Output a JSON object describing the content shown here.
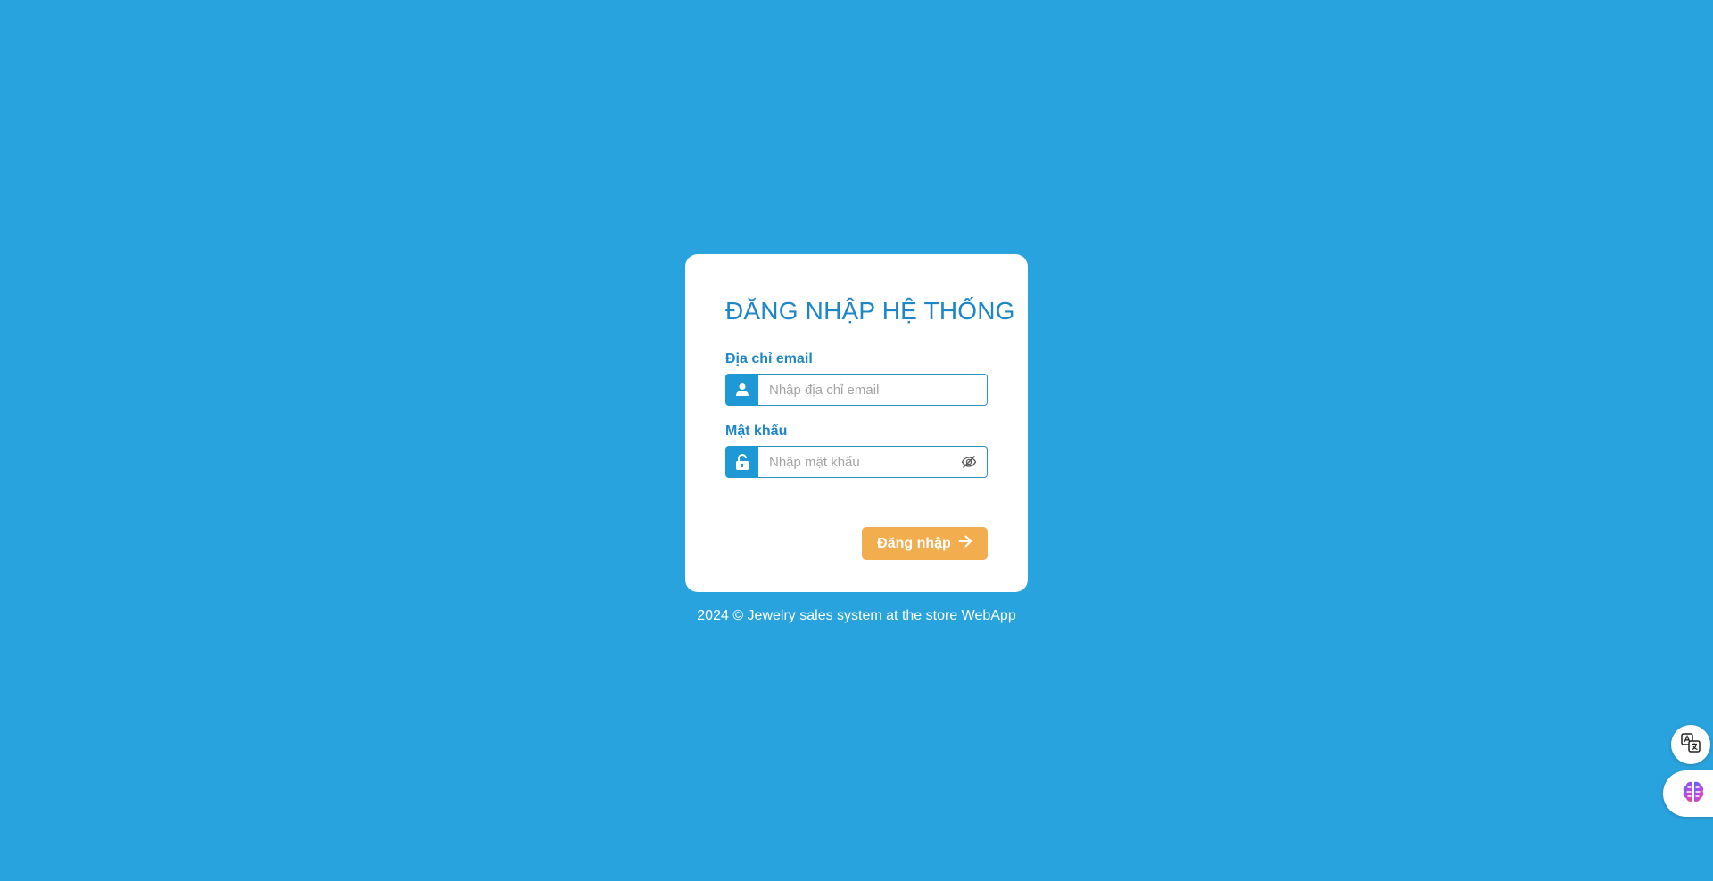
{
  "login": {
    "title": "ĐĂNG NHẬP HỆ THỐNG",
    "email_label": "Địa chỉ email",
    "email_placeholder": "Nhập địa chỉ email",
    "email_value": "",
    "password_label": "Mật khẩu",
    "password_placeholder": "Nhập mật khẩu",
    "password_value": "",
    "submit_label": "Đăng nhập"
  },
  "footer": {
    "text": "2024 © Jewelry sales system at the store WebApp"
  },
  "icons": {
    "email_addon": "user-icon",
    "password_addon": "unlock-icon",
    "password_toggle": "eye-slash-icon",
    "submit": "arrow-right-icon",
    "floating_1": "translate-icon",
    "floating_2": "ai-brain-icon"
  },
  "colors": {
    "background": "#29a3dd",
    "primary": "#1d86c8",
    "button": "#f2ad4e"
  }
}
